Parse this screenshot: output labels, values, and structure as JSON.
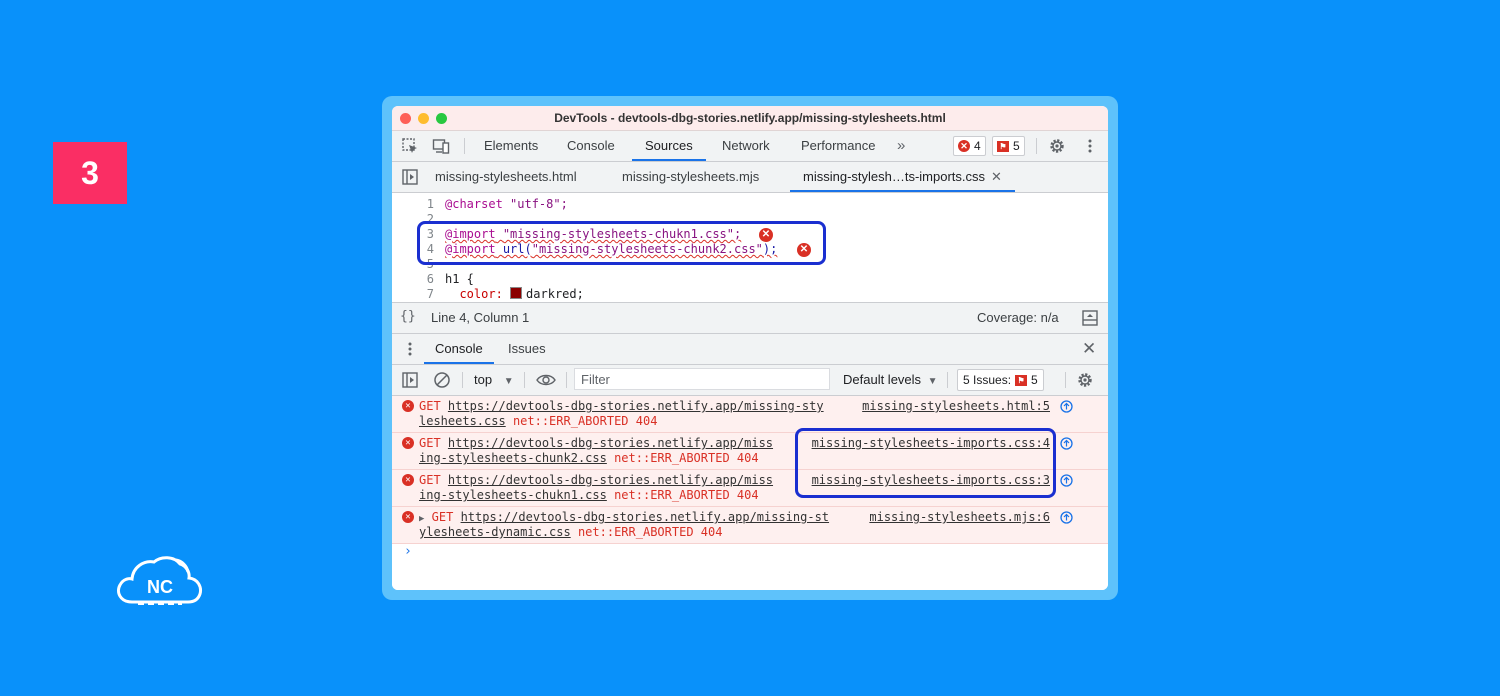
{
  "step_number": "3",
  "logo": {
    "text": "NC"
  },
  "window": {
    "title": "DevTools - devtools-dbg-stories.netlify.app/missing-stylesheets.html"
  },
  "main_tabs": [
    {
      "label": "Elements",
      "active": false
    },
    {
      "label": "Console",
      "active": false
    },
    {
      "label": "Sources",
      "active": true
    },
    {
      "label": "Network",
      "active": false
    },
    {
      "label": "Performance",
      "active": false
    }
  ],
  "counters": {
    "errors": "4",
    "issues": "5"
  },
  "file_tabs": [
    {
      "label": "missing-stylesheets.html",
      "active": false
    },
    {
      "label": "missing-stylesheets.mjs",
      "active": false
    },
    {
      "label": "missing-stylesh…ts-imports.css",
      "active": true
    }
  ],
  "editor": {
    "lines": [
      {
        "num": "1",
        "charset_kw": "@charset",
        "value": "\"utf-8\";"
      },
      {
        "num": "2"
      },
      {
        "num": "3",
        "import_kw": "@import",
        "value": "\"missing-stylesheets-chukn1.css\";"
      },
      {
        "num": "4",
        "import_kw": "@import",
        "func": "url(",
        "value": "\"missing-stylesheets-chunk2.css\"",
        "tail": ");"
      },
      {
        "num": "5"
      },
      {
        "num": "6",
        "value": "h1 {"
      },
      {
        "num": "7",
        "prop": "color:",
        "value": "darkred;"
      }
    ]
  },
  "status_bar": {
    "position": "Line 4, Column 1",
    "coverage": "Coverage: n/a"
  },
  "drawer_tabs": [
    {
      "label": "Console",
      "active": true
    },
    {
      "label": "Issues",
      "active": false
    }
  ],
  "console_toolbar": {
    "context": "top",
    "filter_placeholder": "Filter",
    "levels": "Default levels",
    "issues_label": "5 Issues:",
    "issues_count": "5"
  },
  "messages": [
    {
      "method": "GET",
      "url_part1": "https://devtools-dbg-stories.netlify.app/missing-sty",
      "url_part2": "lesheets.css",
      "error": "net::ERR_ABORTED 404",
      "source": "missing-stylesheets.html:5"
    },
    {
      "method": "GET",
      "url_part1": "https://devtools-dbg-stories.netlify.app/miss",
      "url_part2": "ing-stylesheets-chunk2.css",
      "error": "net::ERR_ABORTED 404",
      "source": "missing-stylesheets-imports.css:4"
    },
    {
      "method": "GET",
      "url_part1": "https://devtools-dbg-stories.netlify.app/miss",
      "url_part2": "ing-stylesheets-chukn1.css",
      "error": "net::ERR_ABORTED 404",
      "source": "missing-stylesheets-imports.css:3"
    },
    {
      "method": "GET",
      "url_part1": "https://devtools-dbg-stories.netlify.app/missing-st",
      "url_part2": "ylesheets-dynamic.css",
      "error": "net::ERR_ABORTED 404",
      "source": "missing-stylesheets.mjs:6"
    }
  ],
  "colors": {
    "background": "#0991fa",
    "badge": "#fa2e64",
    "highlight": "#1a2fd0",
    "error": "#d93025",
    "accent": "#1a73e8"
  }
}
